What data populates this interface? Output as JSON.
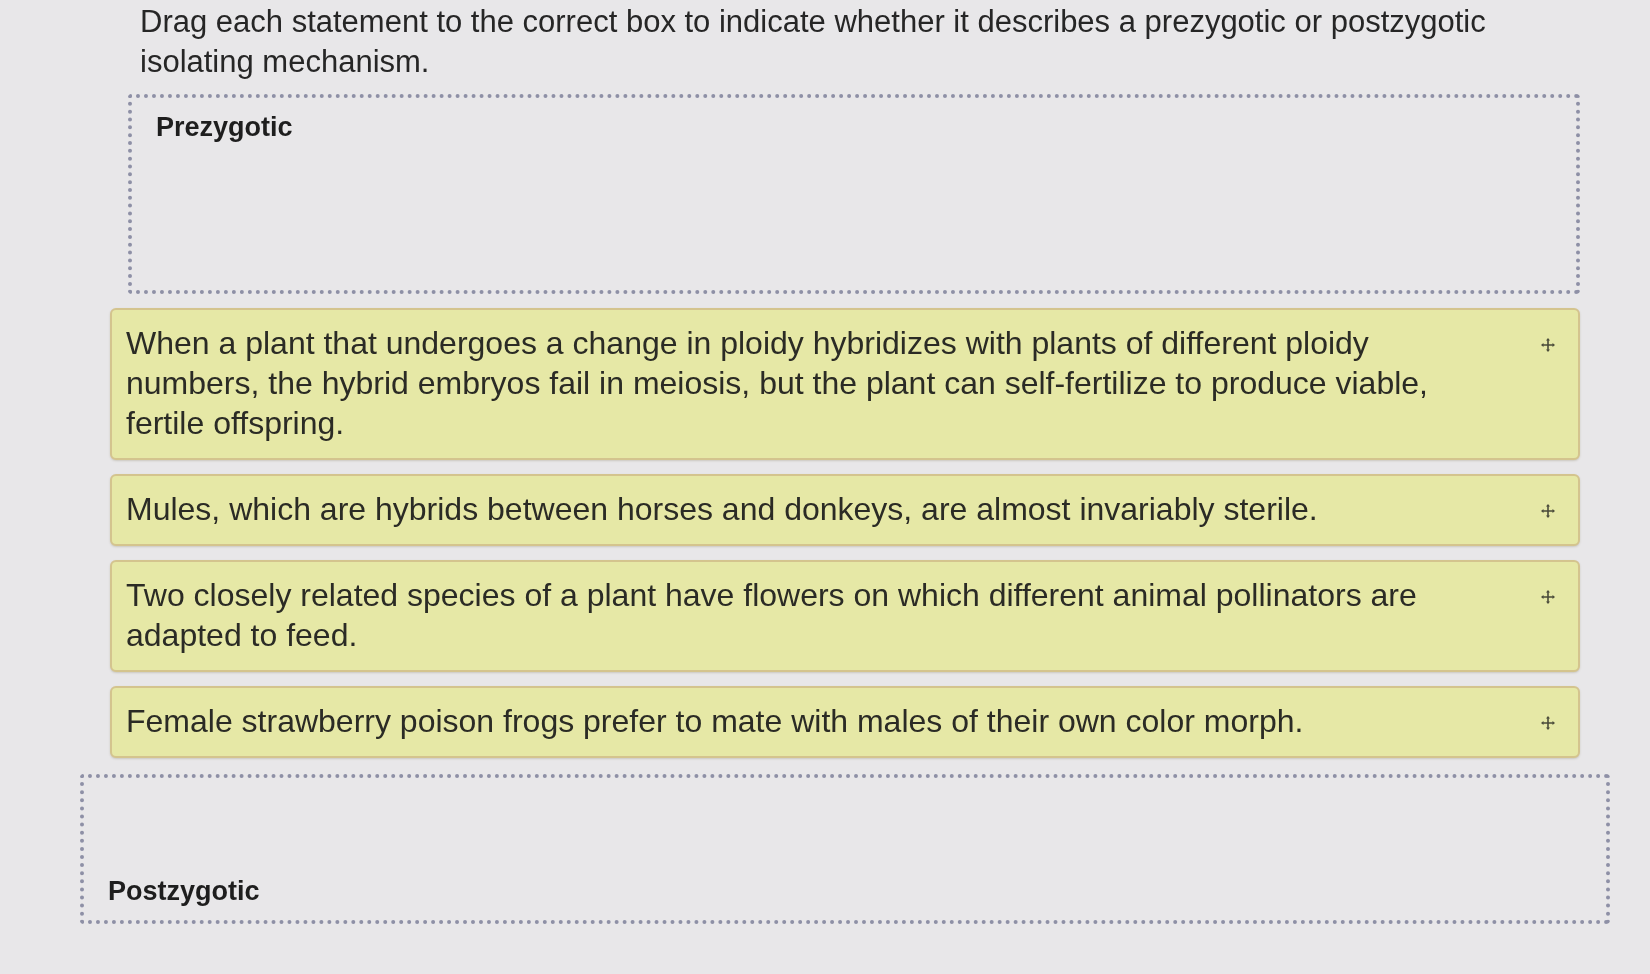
{
  "question": "Drag each statement to the correct box to indicate whether it describes a prezygotic or postzygotic isolating mechanism.",
  "drop_zones": [
    {
      "label": "Prezygotic"
    },
    {
      "label": "Postzygotic"
    }
  ],
  "statements": [
    {
      "text": "When a plant that undergoes a change in ploidy hybridizes with plants of different ploidy numbers, the hybrid embryos fail in meiosis, but the plant can self-fertilize to produce viable, fertile offspring."
    },
    {
      "text": "Mules, which are hybrids between horses and donkeys, are almost invariably sterile."
    },
    {
      "text": "Two closely related species of a plant have flowers on which different animal pollinators are adapted to feed."
    },
    {
      "text": "Female strawberry poison frogs prefer to mate with males of their own color morph."
    }
  ]
}
